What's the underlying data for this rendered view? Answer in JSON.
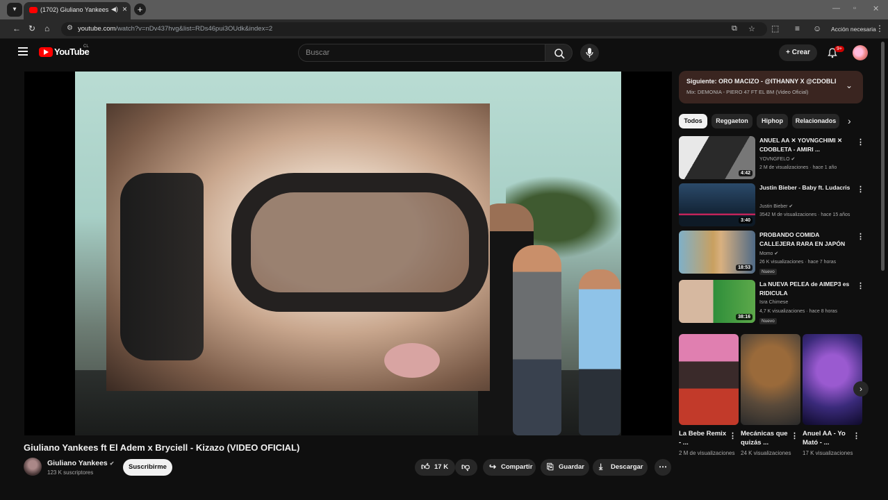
{
  "browser": {
    "tab_title": "(1702) Giuliano Yankees ft El",
    "url_host": "youtube.com",
    "url_rest": "/watch?v=nDv437hvg&list=RDs46pui3OUdk&index=2",
    "account_label": "Acción necesaria"
  },
  "header": {
    "logo_text": "YouTube",
    "country_code": "CL",
    "search_placeholder": "Buscar",
    "create_label": "Crear",
    "notif_badge": "9+"
  },
  "video": {
    "title": "Giuliano Yankees ft El Adem x Bryciell - Kizazo (VIDEO OFICIAL)",
    "channel": "Giuliano Yankees",
    "subscribers": "123 K suscriptores",
    "subscribe_label": "Suscribirme",
    "likes": "17 K",
    "share_label": "Compartir",
    "save_label": "Guardar",
    "download_label": "Descargar"
  },
  "next_up": {
    "title": "Siguiente: ORO MACIZO - @ITHANNY X @CDOBLE...",
    "subtitle": "Mix: DEMONIA - PIERO 47 FT EL BM (Video Oficial)"
  },
  "chips": [
    "Todos",
    "Reggaeton",
    "Hiphop",
    "Relacionados"
  ],
  "recommendations": [
    {
      "title": "ANUEL AA ✕ YOVNGCHIMI ✕ CDOBLETA - AMIRI ...",
      "channel": "YOVNGFELO ✔",
      "meta": "2 M de visualizaciones · hace 1 año",
      "duration": "4:42",
      "badge": ""
    },
    {
      "title": "Justin Bieber - Baby ft. Ludacris",
      "channel": "Justin Bieber ✔",
      "meta": "3542 M de visualizaciones · hace 15 años",
      "duration": "3:40",
      "badge": ""
    },
    {
      "title": "PROBANDO COMIDA CALLEJERA RARA EN JAPÓN",
      "channel": "Momo ✔",
      "meta": "26 K visualizaciones · hace 7 horas",
      "duration": "18:53",
      "badge": "Nuevo"
    },
    {
      "title": "La NUEVA PELEA de AIMEP3 es RIDICULA",
      "channel": "Isra Chimese",
      "meta": "4,7 K visualizaciones · hace 8 horas",
      "duration": "38:16",
      "badge": "Nuevo"
    }
  ],
  "shorts": [
    {
      "title": "La Bebe Remix - ...",
      "views": "2 M de visualizaciones"
    },
    {
      "title": "Mecánicas que quizás ...",
      "views": "24 K visualizaciones"
    },
    {
      "title": "Anuel AA - Yo Mató - ...",
      "views": "17 K visualizaciones"
    }
  ],
  "icons": {
    "search": "search-icon",
    "mic": "microphone-icon",
    "bell": "bell-icon",
    "like": "thumbs-up-icon",
    "dislike": "thumbs-down-icon"
  },
  "colors": {
    "brand": "#ff0000",
    "background": "#0f0f0f"
  }
}
